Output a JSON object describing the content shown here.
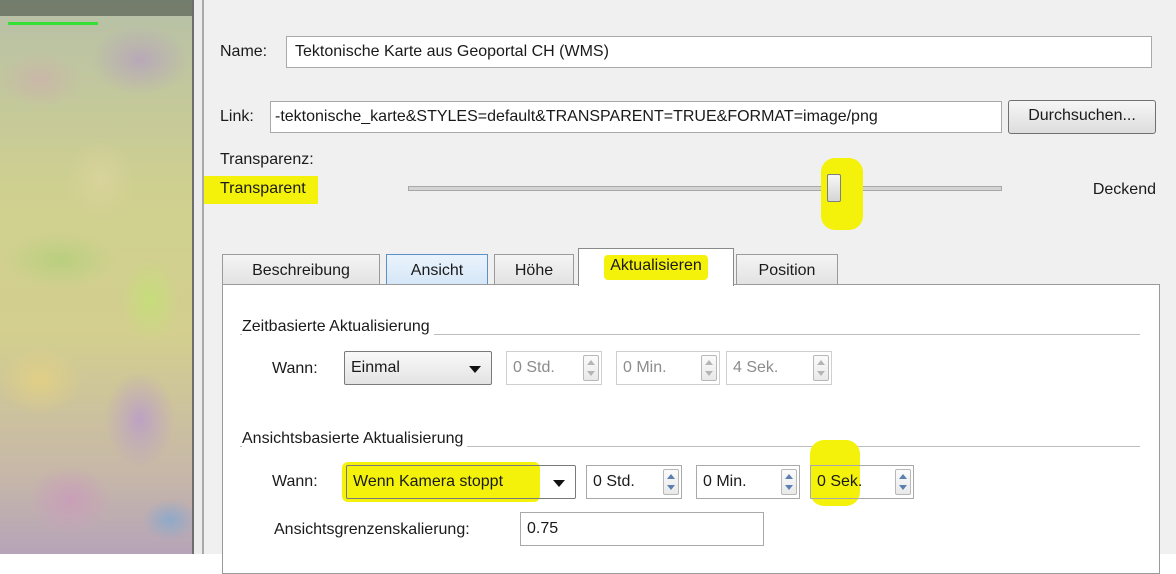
{
  "layer": {
    "name_label": "Name:",
    "name_value": "Tektonische Karte aus Geoportal CH (WMS)",
    "link_label": "Link:",
    "link_value": "-tektonische_karte&STYLES=default&TRANSPARENT=TRUE&FORMAT=image/png",
    "browse_button": "Durchsuchen..."
  },
  "transparency": {
    "label": "Transparenz:",
    "min_label": "Transparent",
    "max_label": "Deckend",
    "value_fraction": 0.72
  },
  "tabs": [
    {
      "label": "Beschreibung",
      "active": false
    },
    {
      "label": "Ansicht",
      "active": false
    },
    {
      "label": "Höhe",
      "active": false
    },
    {
      "label": "Aktualisieren",
      "active": true
    },
    {
      "label": "Position",
      "active": false
    }
  ],
  "time_refresh": {
    "title": "Zeitbasierte Aktualisierung",
    "when_label": "Wann:",
    "when_value": "Einmal",
    "hours": "0 Std.",
    "minutes": "0 Min.",
    "seconds": "4 Sek.",
    "enabled": false
  },
  "view_refresh": {
    "title": "Ansichtsbasierte Aktualisierung",
    "when_label": "Wann:",
    "when_value": "Wenn Kamera stoppt",
    "hours": "0 Std.",
    "minutes": "0 Min.",
    "seconds": "0 Sek.",
    "scale_label": "Ansichtsgrenzenskalierung:",
    "scale_value": "0.75"
  },
  "colors": {
    "highlight": "#f4f20a",
    "spin_arrow": "#5b7fb0"
  }
}
